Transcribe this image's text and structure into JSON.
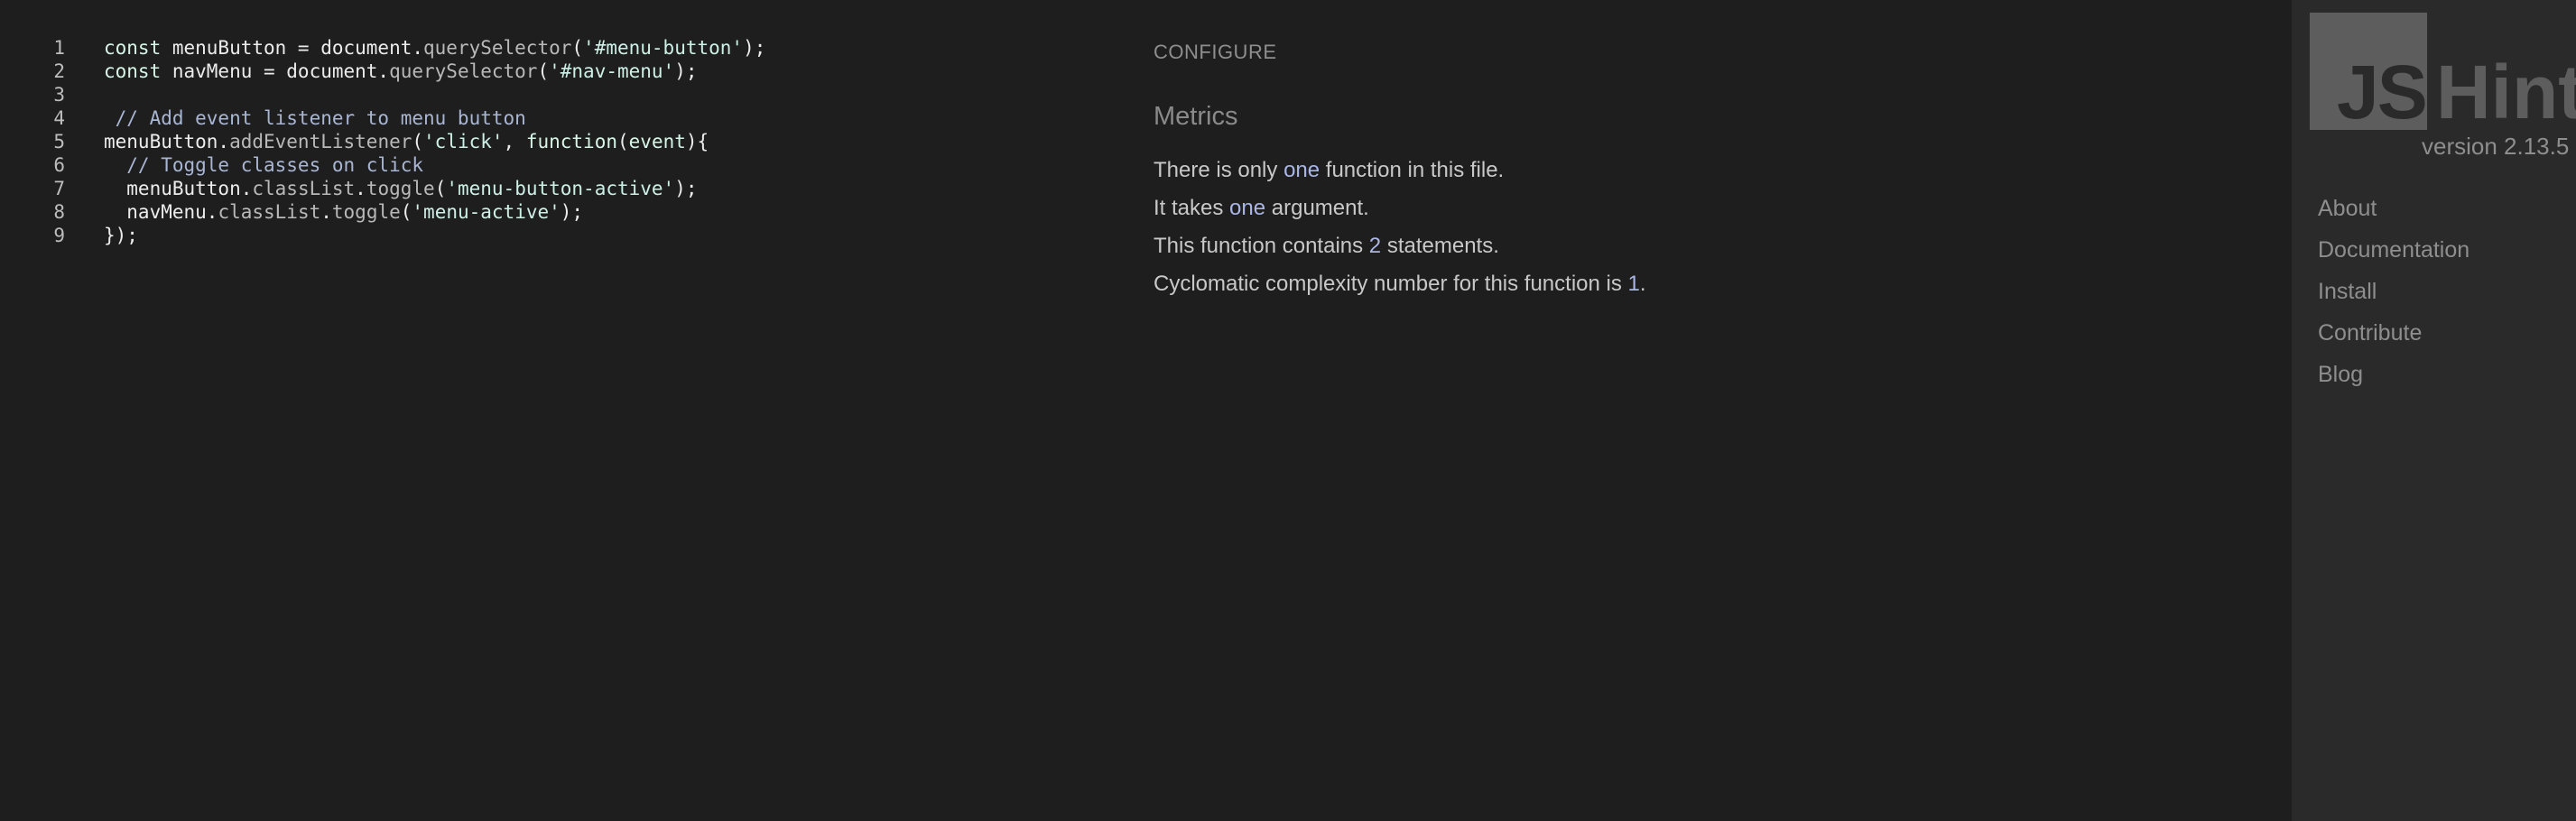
{
  "editor": {
    "lines": [
      {
        "number": "1",
        "tokens": [
          {
            "t": "kw",
            "v": "const"
          },
          {
            "t": "plain",
            "v": " menuButton = document."
          },
          {
            "t": "prop",
            "v": "querySelector"
          },
          {
            "t": "plain",
            "v": "("
          },
          {
            "t": "str",
            "v": "'#menu-button'"
          },
          {
            "t": "plain",
            "v": ");"
          }
        ]
      },
      {
        "number": "2",
        "tokens": [
          {
            "t": "kw",
            "v": "const"
          },
          {
            "t": "plain",
            "v": " navMenu = document."
          },
          {
            "t": "prop",
            "v": "querySelector"
          },
          {
            "t": "plain",
            "v": "("
          },
          {
            "t": "str",
            "v": "'#nav-menu'"
          },
          {
            "t": "plain",
            "v": ");"
          }
        ]
      },
      {
        "number": "3",
        "tokens": []
      },
      {
        "number": "4",
        "tokens": [
          {
            "t": "com",
            "v": " // Add event listener to menu button"
          }
        ]
      },
      {
        "number": "5",
        "tokens": [
          {
            "t": "plain",
            "v": "menuButton."
          },
          {
            "t": "prop",
            "v": "addEventListener"
          },
          {
            "t": "plain",
            "v": "("
          },
          {
            "t": "str",
            "v": "'click'"
          },
          {
            "t": "plain",
            "v": ", "
          },
          {
            "t": "kw",
            "v": "function"
          },
          {
            "t": "plain",
            "v": "("
          },
          {
            "t": "kw",
            "v": "event"
          },
          {
            "t": "plain",
            "v": "){"
          }
        ]
      },
      {
        "number": "6",
        "tokens": [
          {
            "t": "com",
            "v": "  // Toggle classes on click"
          }
        ]
      },
      {
        "number": "7",
        "tokens": [
          {
            "t": "plain",
            "v": "  menuButton."
          },
          {
            "t": "prop",
            "v": "classList"
          },
          {
            "t": "plain",
            "v": "."
          },
          {
            "t": "prop",
            "v": "toggle"
          },
          {
            "t": "plain",
            "v": "("
          },
          {
            "t": "str",
            "v": "'menu-button-active'"
          },
          {
            "t": "plain",
            "v": ");"
          }
        ]
      },
      {
        "number": "8",
        "tokens": [
          {
            "t": "plain",
            "v": "  navMenu."
          },
          {
            "t": "prop",
            "v": "classList"
          },
          {
            "t": "plain",
            "v": "."
          },
          {
            "t": "prop",
            "v": "toggle"
          },
          {
            "t": "plain",
            "v": "("
          },
          {
            "t": "str",
            "v": "'menu-active'"
          },
          {
            "t": "plain",
            "v": ");"
          }
        ]
      },
      {
        "number": "9",
        "tokens": [
          {
            "t": "plain",
            "v": "});"
          }
        ]
      }
    ]
  },
  "report": {
    "configure_label": "CONFIGURE",
    "metrics_heading": "Metrics",
    "metrics": [
      {
        "parts": [
          {
            "v": "There is only "
          },
          {
            "v": "one",
            "hl": true
          },
          {
            "v": " function in this file."
          }
        ]
      },
      {
        "parts": [
          {
            "v": "It takes "
          },
          {
            "v": "one",
            "hl": true
          },
          {
            "v": " argument."
          }
        ]
      },
      {
        "parts": [
          {
            "v": "This function contains "
          },
          {
            "v": "2",
            "hl": true
          },
          {
            "v": " statements."
          }
        ]
      },
      {
        "parts": [
          {
            "v": "Cyclomatic complexity number for this function is "
          },
          {
            "v": "1",
            "hl": true
          },
          {
            "v": "."
          }
        ]
      }
    ]
  },
  "sidebar": {
    "logo_js": "JS",
    "logo_hint": "Hint",
    "version": "version 2.13.5",
    "nav": [
      {
        "label": "About",
        "name": "nav-about"
      },
      {
        "label": "Documentation",
        "name": "nav-documentation"
      },
      {
        "label": "Install",
        "name": "nav-install"
      },
      {
        "label": "Contribute",
        "name": "nav-contribute"
      },
      {
        "label": "Blog",
        "name": "nav-blog"
      }
    ]
  }
}
